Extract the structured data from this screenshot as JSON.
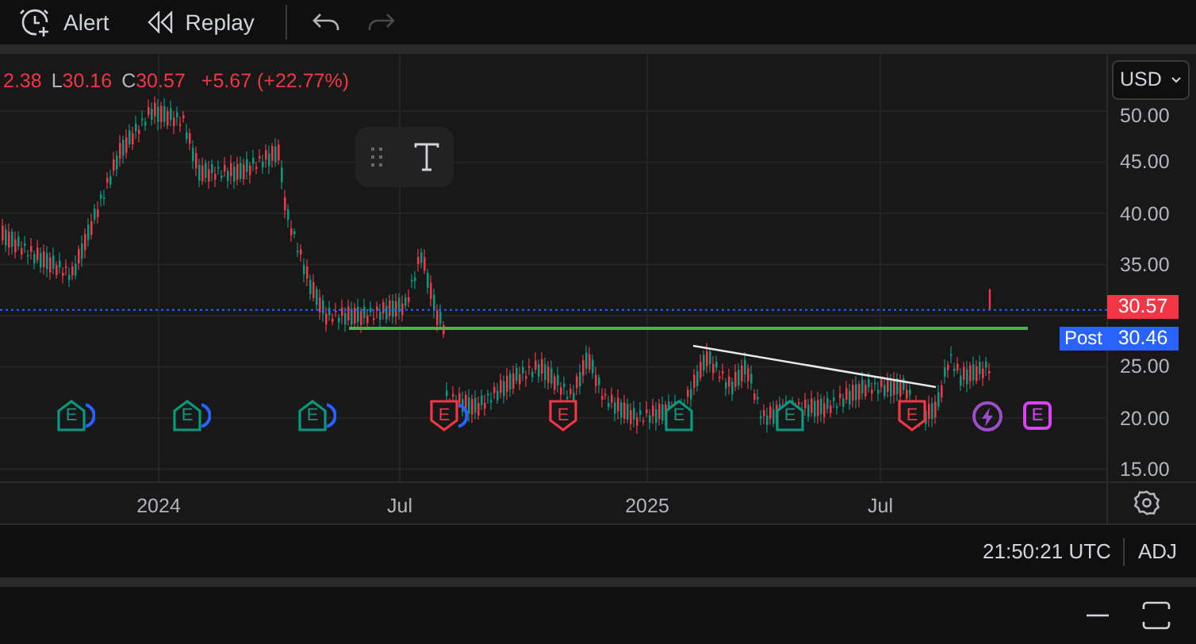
{
  "toolbar": {
    "alert": "Alert",
    "replay": "Replay",
    "undo_disabled": false,
    "redo_disabled": true
  },
  "legend": {
    "items": [
      {
        "value": "2.38"
      },
      {
        "label": "L",
        "value": "30.16"
      },
      {
        "label": "C",
        "value": "30.57"
      }
    ],
    "change": "+5.67 (+22.77%)"
  },
  "currency": "USD",
  "price_axis": [
    "50.00",
    "45.00",
    "40.00",
    "35.00",
    "25.00",
    "20.00",
    "15.00"
  ],
  "last_price": "30.57",
  "post_market": {
    "label": "Post",
    "price": "30.46"
  },
  "time_axis": [
    "2024",
    "Jul",
    "2025",
    "Jul"
  ],
  "events": [
    {
      "kind": "earnings",
      "label": "E",
      "color": "#089981",
      "dividend": true
    },
    {
      "kind": "earnings",
      "label": "E",
      "color": "#089981",
      "dividend": true
    },
    {
      "kind": "earnings",
      "label": "E",
      "color": "#089981",
      "dividend": true
    },
    {
      "kind": "earnings",
      "label": "E",
      "color": "#f23645",
      "dividend": true
    },
    {
      "kind": "earnings",
      "label": "E",
      "color": "#f23645",
      "dividend": false
    },
    {
      "kind": "earnings",
      "label": "E",
      "color": "#089981",
      "dividend": false
    },
    {
      "kind": "earnings",
      "label": "E",
      "color": "#089981",
      "dividend": false
    },
    {
      "kind": "earnings",
      "label": "E",
      "color": "#f23645",
      "dividend": false
    },
    {
      "kind": "news",
      "color": "#9c4dcc"
    },
    {
      "kind": "upcoming",
      "label": "E",
      "color": "#e040fb"
    }
  ],
  "status_bar": {
    "time": "21:50:21 UTC",
    "adjust": "ADJ"
  }
}
